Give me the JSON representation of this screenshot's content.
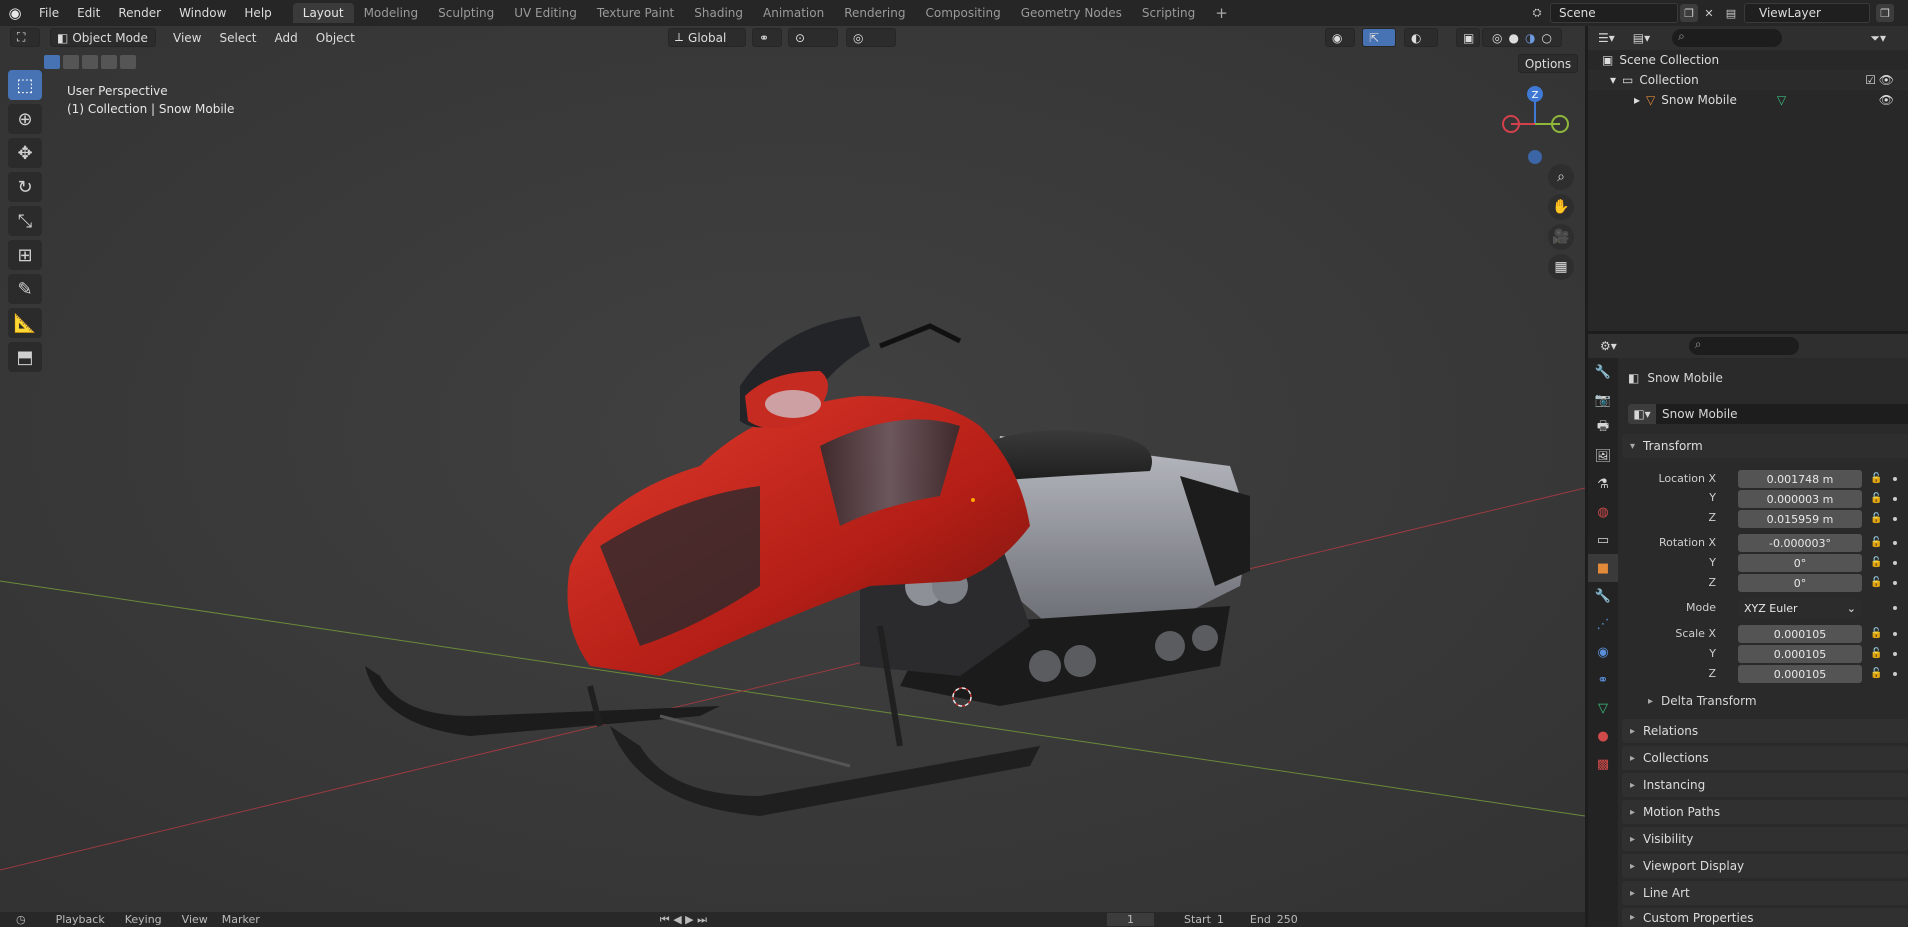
{
  "topbar": {
    "menu": [
      "File",
      "Edit",
      "Render",
      "Window",
      "Help"
    ],
    "workspaces": [
      "Layout",
      "Modeling",
      "Sculpting",
      "UV Editing",
      "Texture Paint",
      "Shading",
      "Animation",
      "Rendering",
      "Compositing",
      "Geometry Nodes",
      "Scripting"
    ],
    "active_workspace": "Layout",
    "scene": "Scene",
    "view_layer": "ViewLayer"
  },
  "viewport": {
    "mode": "Object Mode",
    "menu": [
      "View",
      "Select",
      "Add",
      "Object"
    ],
    "orientation": "Global",
    "options_label": "Options",
    "perspective_label": "User Perspective",
    "collection_label": "(1) Collection | Snow Mobile",
    "gizmo": {
      "z": "Z"
    }
  },
  "outliner": {
    "scene_collection": "Scene Collection",
    "collection": "Collection",
    "object": "Snow Mobile"
  },
  "properties": {
    "object_name": "Snow Mobile",
    "datablock_name": "Snow Mobile",
    "transform_label": "Transform",
    "location_label": "Location X",
    "rotation_label": "Rotation X",
    "scale_label": "Scale X",
    "axis_y": "Y",
    "axis_z": "Z",
    "location": [
      "0.001748 m",
      "0.000003 m",
      "0.015959 m"
    ],
    "rotation": [
      "-0.000003°",
      "0°",
      "0°"
    ],
    "mode_label": "Mode",
    "mode_value": "XYZ Euler",
    "scale": [
      "0.000105",
      "0.000105",
      "0.000105"
    ],
    "delta_transform": "Delta Transform",
    "panels": [
      "Relations",
      "Collections",
      "Instancing",
      "Motion Paths",
      "Visibility",
      "Viewport Display",
      "Line Art",
      "Custom Properties"
    ]
  },
  "timeline": {
    "items": [
      "Playback",
      "Keying",
      "View",
      "Marker"
    ],
    "start_label": "Start",
    "start_value": "1",
    "end_label": "End",
    "end_value": "250"
  },
  "colors": {
    "accent": "#4772b3",
    "x_axis": "#d4404c",
    "y_axis": "#8fb83b",
    "z_axis": "#3f79d4",
    "snow_red": "#c8281e"
  }
}
